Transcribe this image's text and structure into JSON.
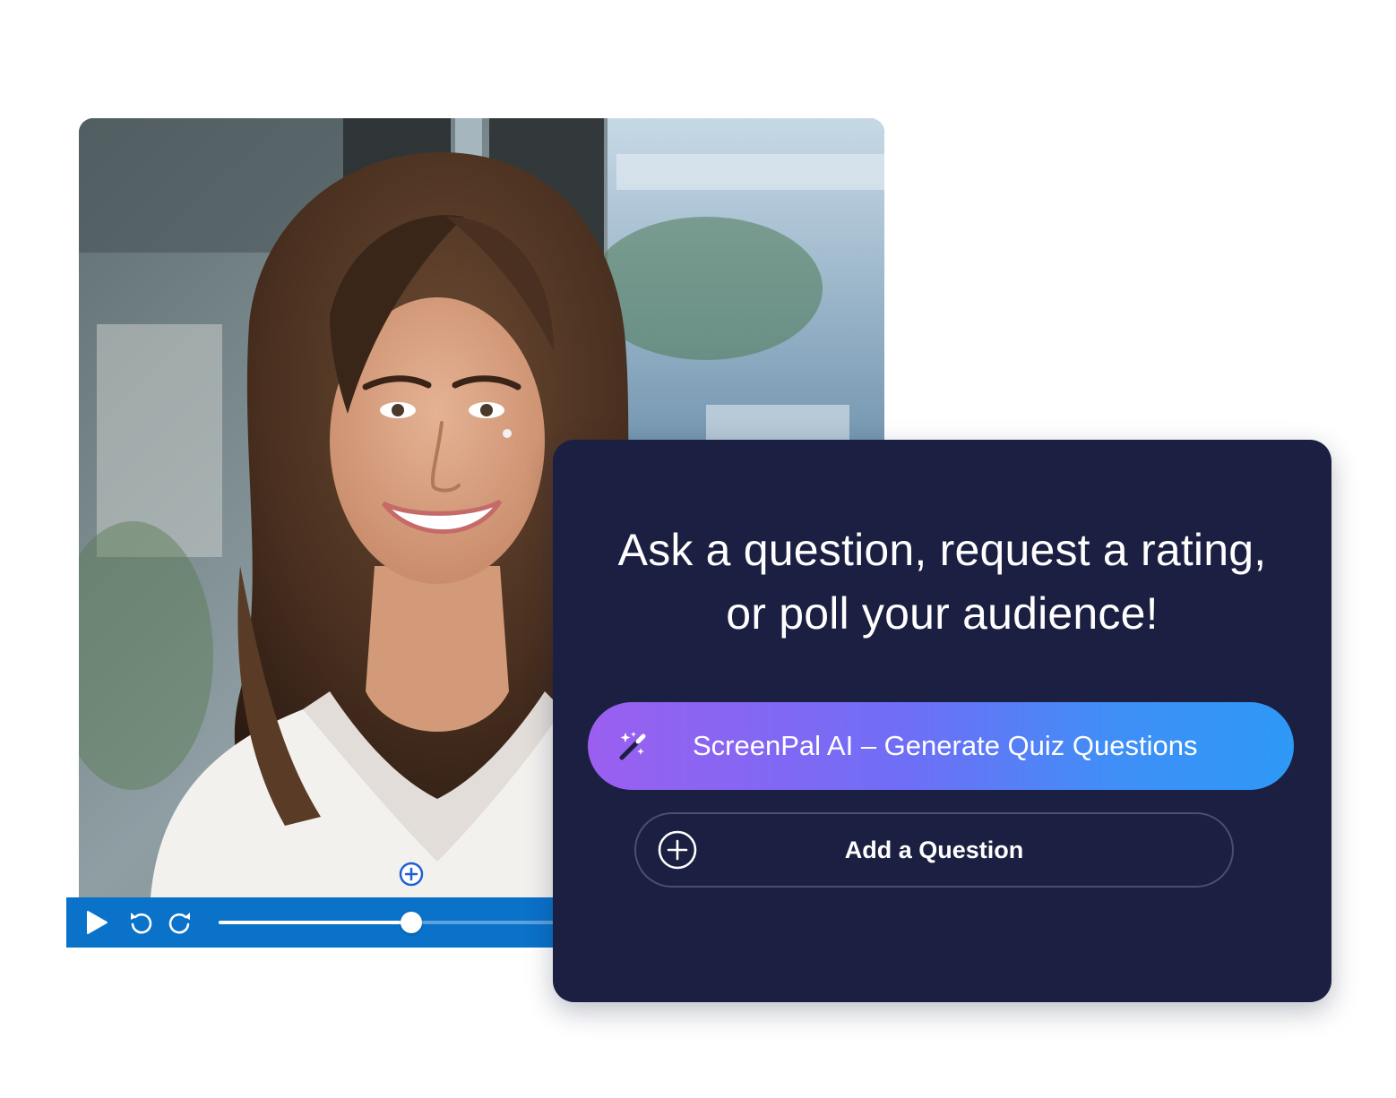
{
  "quiz_panel": {
    "headline_line1": "Ask a question, request a rating,",
    "headline_line2": "or poll your audience!",
    "ai_button_label": "ScreenPal AI – Generate Quiz Questions",
    "ai_button_icon": "magic-wand-icon",
    "add_question_label": "Add a Question",
    "add_question_icon": "plus-circle-icon"
  },
  "player": {
    "progress": 0.55,
    "controls": [
      "play-icon",
      "rewind-icon",
      "forward-icon"
    ]
  },
  "colors": {
    "panel_bg": "#1b1f41",
    "control_bar": "#0a72c9",
    "ai_gradient_start": "#9b5ff0",
    "ai_gradient_end": "#2d99f7",
    "marker": "#1f5fd6"
  }
}
